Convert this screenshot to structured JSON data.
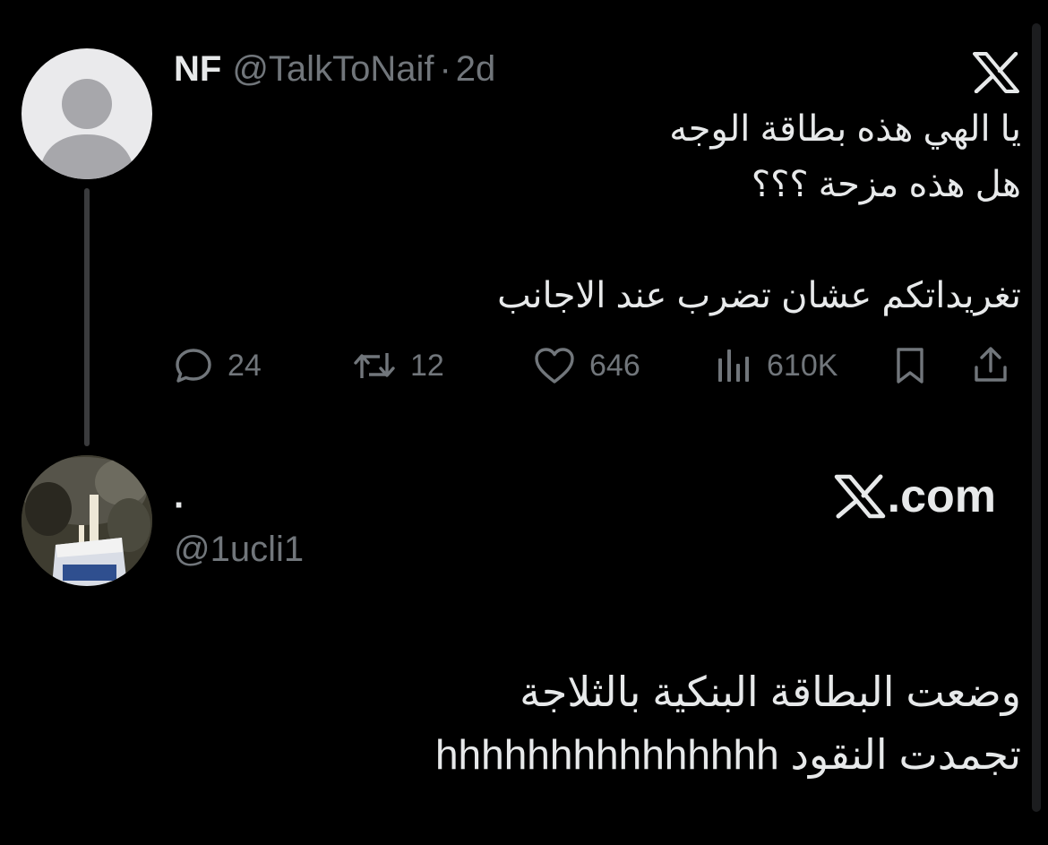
{
  "tweet1": {
    "name": "NF",
    "handle": "@TalkToNaif",
    "separator": "·",
    "time": "2d",
    "lines": [
      "يا الهي هذه بطاقة الوجه",
      "هل هذه مزحة ؟؟؟",
      "تغريداتكم عشان تضرب عند الاجانب"
    ],
    "actions": {
      "replies": "24",
      "reposts": "12",
      "likes": "646",
      "views": "610K"
    },
    "platform_icon": "x-logo-icon"
  },
  "tweet2": {
    "name": "·",
    "handle": "@1ucli1",
    "brand_text": ".com",
    "lines": [
      "وضعت البطاقة البنكية بالثلاجة",
      "تجمدت النقود hhhhhhhhhhhhhhh"
    ]
  },
  "colors": {
    "background": "#000000",
    "primary_text": "#e7e9ea",
    "secondary_text": "#71767b",
    "thread_line": "#3a3b3d"
  }
}
